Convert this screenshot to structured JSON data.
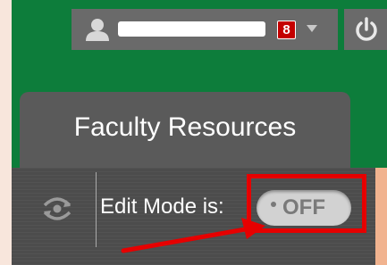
{
  "header": {
    "user_name": "",
    "notification_count": "8",
    "icons": {
      "user": "user-icon",
      "dropdown": "chevron-down-icon",
      "power": "power-icon"
    }
  },
  "tab": {
    "label": "Faculty Resources"
  },
  "toolbar": {
    "edit_mode_label": "Edit Mode is:",
    "edit_mode_state": "OFF",
    "icons": {
      "refresh": "refresh-view-icon"
    }
  },
  "annotation": {
    "highlight_color": "#e60000"
  },
  "colors": {
    "header_green": "#0d7d3b",
    "pill_gray": "#6a6a6a",
    "tab_gray": "#5a5a5a",
    "toolbar_dark": "#4c4c4c",
    "badge_red": "#c40000"
  }
}
